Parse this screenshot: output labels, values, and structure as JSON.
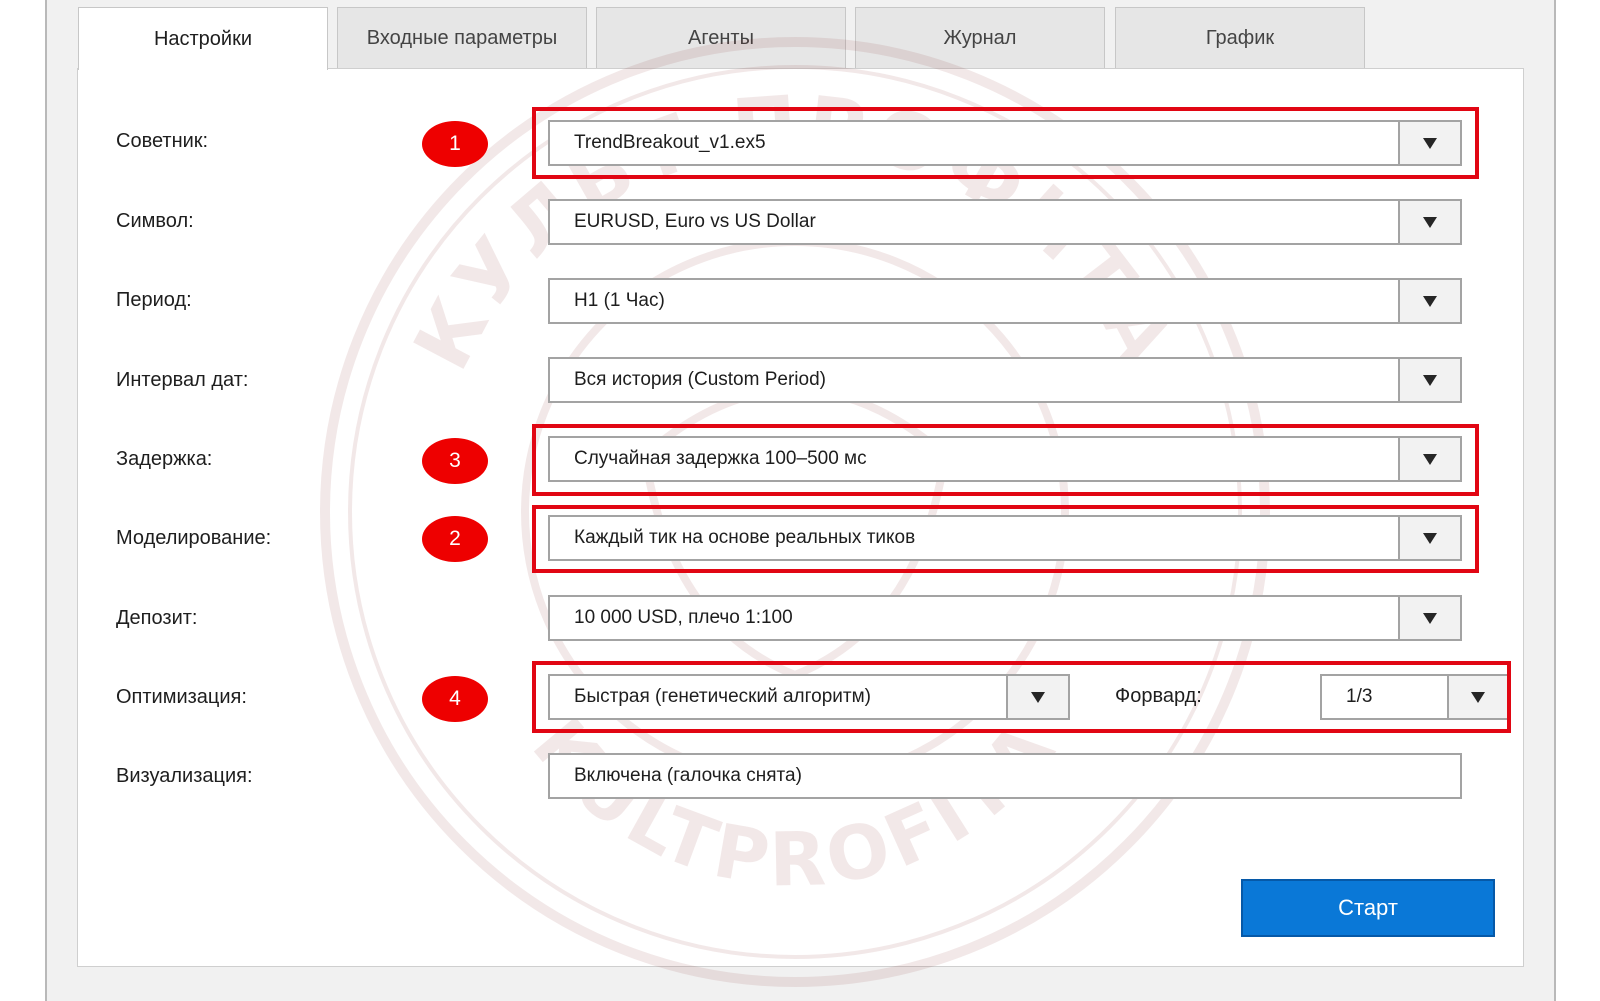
{
  "tabs": [
    {
      "label": "Настройки",
      "active": true
    },
    {
      "label": "Входные параметры",
      "active": false
    },
    {
      "label": "Агенты",
      "active": false
    },
    {
      "label": "Журнал",
      "active": false
    },
    {
      "label": "График",
      "active": false
    }
  ],
  "fields": {
    "expert": {
      "label": "Советник:",
      "value": "TrendBreakout_v1.ex5"
    },
    "symbol": {
      "label": "Символ:",
      "value": "EURUSD, Euro vs US Dollar"
    },
    "period": {
      "label": "Период:",
      "value": "H1 (1 Час)"
    },
    "date_range": {
      "label": "Интервал дат:",
      "value": "Вся история (Custom Period)"
    },
    "delay": {
      "label": "Задержка:",
      "value": "Случайная задержка 100–500 мс"
    },
    "modeling": {
      "label": "Моделирование:",
      "value": "Каждый тик на основе реальных тиков"
    },
    "deposit": {
      "label": "Депозит:",
      "value": "10 000 USD, плечо 1:100"
    },
    "optimization": {
      "label": "Оптимизация:",
      "value": "Быстрая (генетический алгоритм)"
    },
    "forward": {
      "label": "Форвард:",
      "value": "1/3"
    },
    "visualization": {
      "label": "Визуализация:",
      "value": "Включена (галочка снята)"
    }
  },
  "markers": {
    "expert": "1",
    "modeling": "2",
    "delay": "3",
    "optimization": "4"
  },
  "buttons": {
    "start_label": "Старт"
  },
  "watermark": {
    "text_top": "КУЛЬТ ПРОФИТА",
    "text_bottom": "KULTPROFITA"
  },
  "colors": {
    "highlight": "#e10613",
    "badge": "#ee0000",
    "primary_button": "#0a78d7",
    "panel_bg": "#ffffff",
    "window_bg": "#f1f1f1"
  },
  "icons": {
    "dropdown": "triangle-down-icon"
  }
}
